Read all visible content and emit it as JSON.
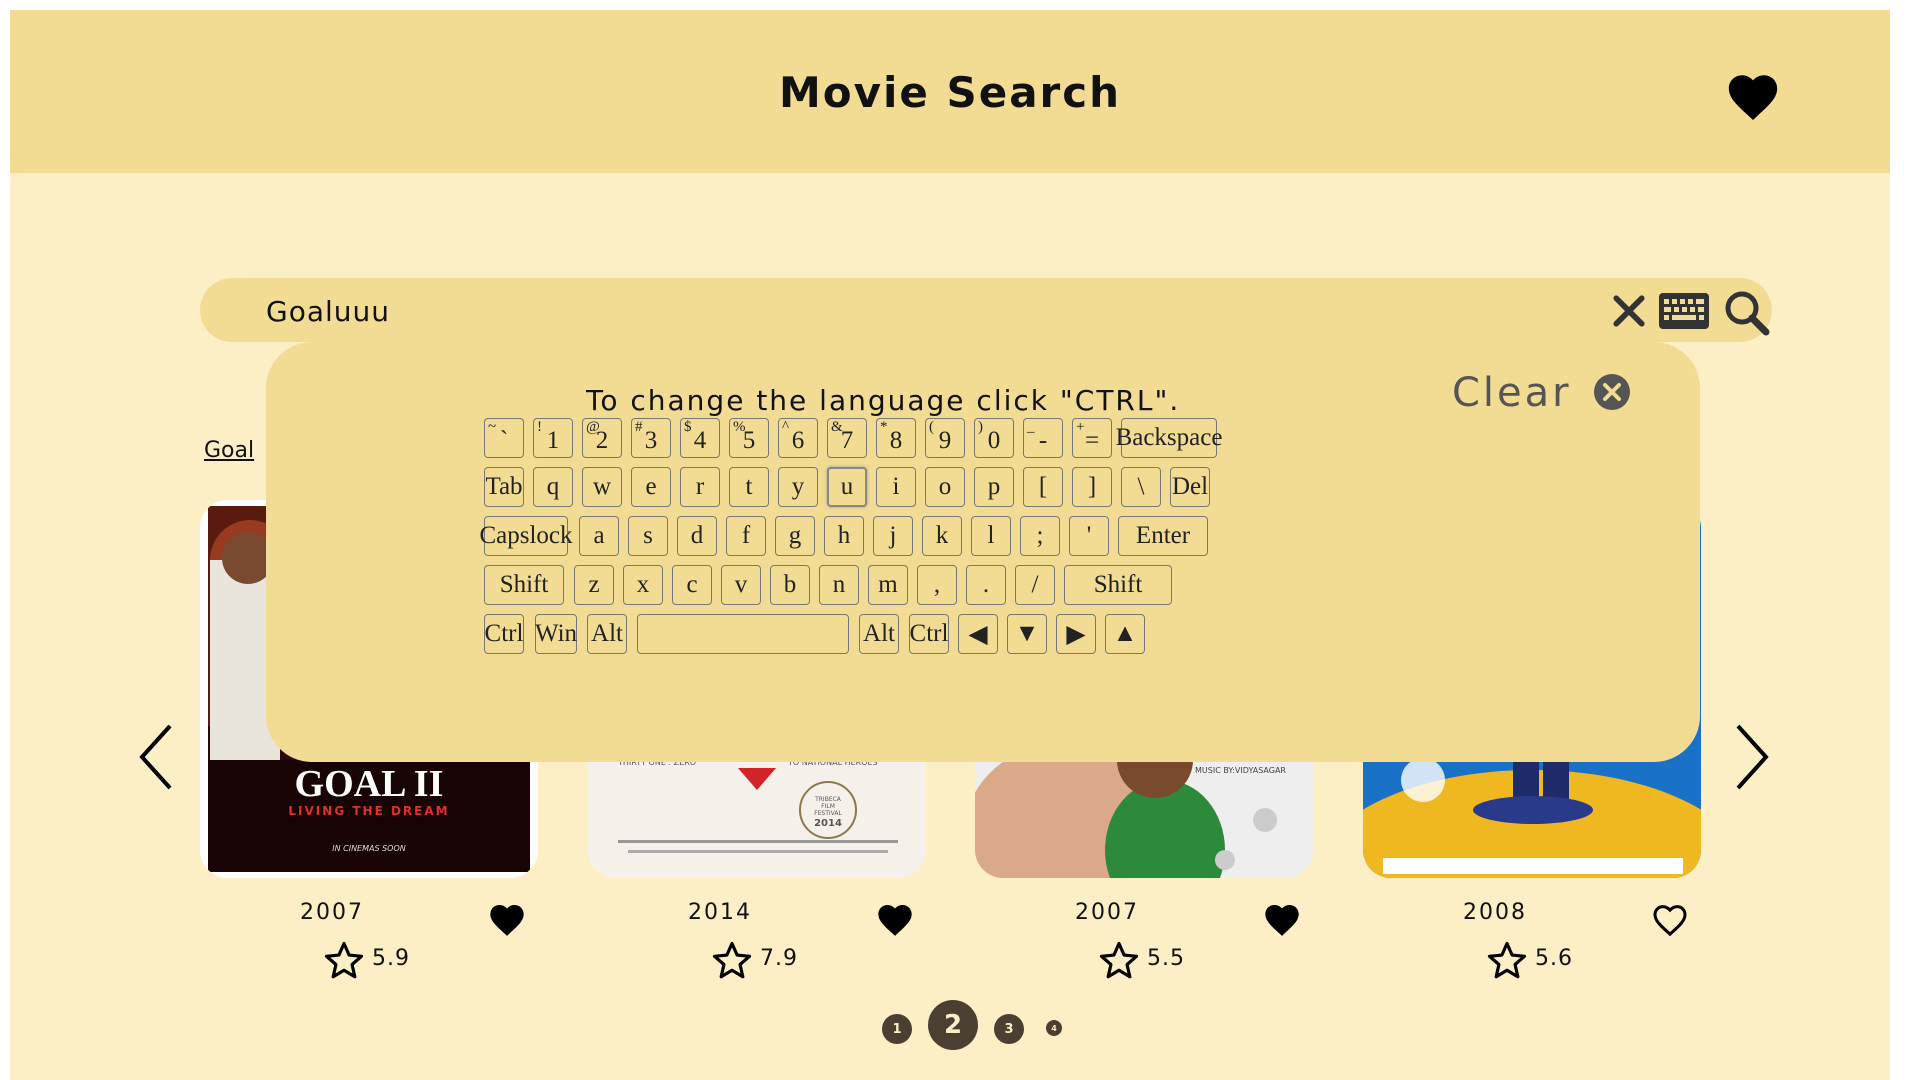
{
  "header": {
    "title": "Movie Search",
    "favorites_icon": "heart-icon"
  },
  "search": {
    "value": "Goaluuu",
    "clear_icon": "x-icon",
    "keyboard_icon": "keyboard-icon",
    "search_icon": "search-icon"
  },
  "results_label": "Goal",
  "keyboard": {
    "hint": "To change the language click \"CTRL\".",
    "clear_label": "Clear",
    "row1": [
      {
        "shift": "~",
        "label": "`"
      },
      {
        "shift": "!",
        "label": "1"
      },
      {
        "shift": "@",
        "label": "2"
      },
      {
        "shift": "#",
        "label": "3"
      },
      {
        "shift": "$",
        "label": "4"
      },
      {
        "shift": "%",
        "label": "5"
      },
      {
        "shift": "^",
        "label": "6"
      },
      {
        "shift": "&",
        "label": "7"
      },
      {
        "shift": "*",
        "label": "8"
      },
      {
        "shift": "(",
        "label": "9"
      },
      {
        "shift": ")",
        "label": "0"
      },
      {
        "shift": "_",
        "label": "-"
      },
      {
        "shift": "+",
        "label": "="
      },
      {
        "shift": "",
        "label": "Backspace"
      }
    ],
    "row2": [
      "Tab",
      "q",
      "w",
      "e",
      "r",
      "t",
      "y",
      "u",
      "i",
      "o",
      "p",
      "[",
      "]",
      "\\",
      "Del"
    ],
    "row3": [
      "Capslock",
      "a",
      "s",
      "d",
      "f",
      "g",
      "h",
      "j",
      "k",
      "l",
      ";",
      "'",
      "Enter"
    ],
    "row4": [
      "Shift",
      "z",
      "x",
      "c",
      "v",
      "b",
      "n",
      "m",
      ",",
      ".",
      "/",
      "Shift"
    ],
    "row5": [
      "Ctrl",
      "Win",
      "Alt",
      "",
      "Alt",
      "Ctrl",
      "◀",
      "▼",
      "▶",
      "▲"
    ],
    "active_key": "u"
  },
  "movies": [
    {
      "year": "2007",
      "rating": "5.9",
      "favorite": true,
      "poster_title": "GOAL II",
      "poster_subtitle": "LIVING THE DREAM",
      "poster_caption": "IN CINEMAS SOON"
    },
    {
      "year": "2014",
      "rating": "7.9",
      "favorite": true,
      "poster_text1": "THIRTY ONE : ZERO",
      "poster_text2": "TO NATIONAL HEROES",
      "poster_laurel": "TRIBECA FILM FESTIVAL",
      "poster_laurel_year": "2014"
    },
    {
      "year": "2007",
      "rating": "5.5",
      "favorite": true,
      "poster_text": "MUSIC BY:VIDYASAGAR"
    },
    {
      "year": "2008",
      "rating": "5.6",
      "favorite": false
    }
  ],
  "pagination": {
    "pages": [
      "1",
      "2",
      "3",
      "4"
    ],
    "current": "2"
  },
  "colors": {
    "page_bg": "#fcefc6",
    "header_bg": "#f2dc94",
    "accent_dark": "#4a3f30"
  }
}
